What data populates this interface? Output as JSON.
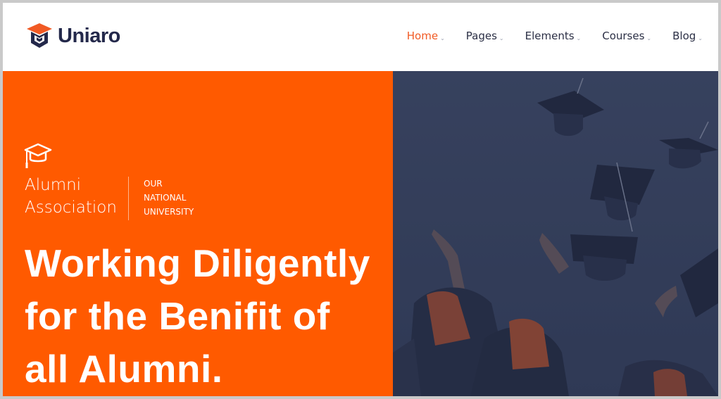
{
  "brand": {
    "name": "Uniaro"
  },
  "nav": [
    {
      "label": "Home",
      "active": true
    },
    {
      "label": "Pages",
      "active": false
    },
    {
      "label": "Elements",
      "active": false
    },
    {
      "label": "Courses",
      "active": false
    },
    {
      "label": "Blog",
      "active": false
    }
  ],
  "hero": {
    "association_line1": "Alumni",
    "association_line2": "Association",
    "sub_line1": "OUR",
    "sub_line2": "NATIONAL",
    "sub_line3": "UNIVERSITY",
    "heading_line1": "Working Diligently",
    "heading_line2": "for the Benifit of",
    "heading_line3": "all Alumni."
  },
  "colors": {
    "accent": "#ff5a00",
    "nav_active": "#f15a24",
    "brand_dark": "#23284a",
    "photo_overlay": "#3a4460"
  },
  "icons": {
    "logo": "graduation-cap-cube-icon",
    "badge": "graduation-cap-icon",
    "nav_caret": "chevron-down-icon"
  }
}
